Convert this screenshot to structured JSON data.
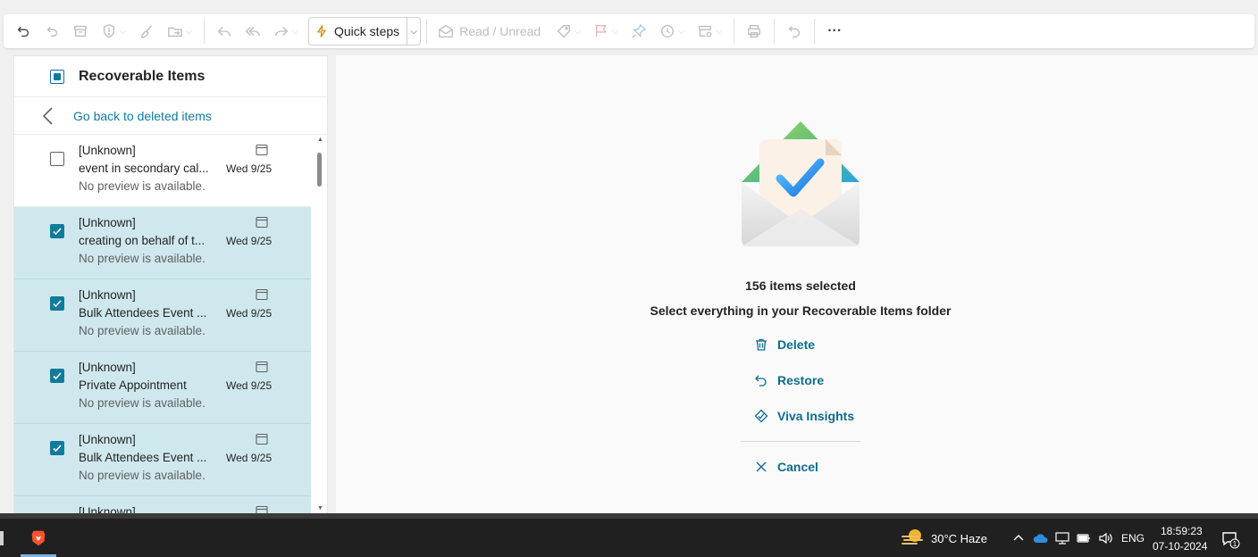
{
  "toolbar": {
    "quick_steps_label": "Quick steps",
    "read_unread_label": "Read / Unread",
    "more_label": "···"
  },
  "list": {
    "title": "Recoverable Items",
    "go_back_label": "Go back to deleted items",
    "rows": [
      {
        "sender": "[Unknown]",
        "subject": "event in secondary cal...",
        "preview": "No preview is available.",
        "date": "Wed 9/25",
        "selected": false
      },
      {
        "sender": "[Unknown]",
        "subject": "creating on behalf of t...",
        "preview": "No preview is available.",
        "date": "Wed 9/25",
        "selected": true
      },
      {
        "sender": "[Unknown]",
        "subject": "Bulk Attendees Event ...",
        "preview": "No preview is available.",
        "date": "Wed 9/25",
        "selected": true
      },
      {
        "sender": "[Unknown]",
        "subject": "Private Appointment",
        "preview": "No preview is available.",
        "date": "Wed 9/25",
        "selected": true
      },
      {
        "sender": "[Unknown]",
        "subject": "Bulk Attendees Event ...",
        "preview": "No preview is available.",
        "date": "Wed 9/25",
        "selected": true
      },
      {
        "sender": "[Unknown]",
        "subject": "",
        "preview": "",
        "date": "",
        "selected": true
      }
    ]
  },
  "reading": {
    "count_text": "156 items selected",
    "select_all_text": "Select everything in your Recoverable Items folder",
    "delete_label": "Delete",
    "restore_label": "Restore",
    "viva_label": "Viva Insights",
    "cancel_label": "Cancel"
  },
  "taskbar": {
    "weather": "30°C  Haze",
    "language": "ENG",
    "time": "18:59:23",
    "date": "07-10-2024",
    "notification_count": "1"
  },
  "colors": {
    "accent": "#0f7c9e",
    "selected_row": "#cfe8ee",
    "taskbar": "#202020"
  }
}
